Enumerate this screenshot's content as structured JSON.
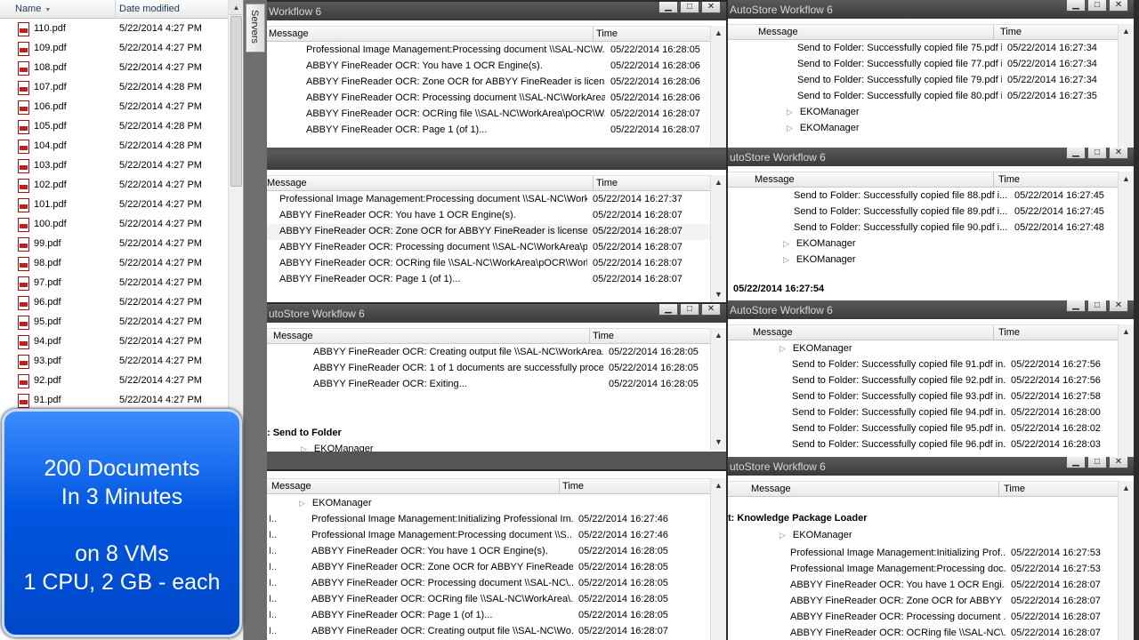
{
  "explorer": {
    "col_name": "Name",
    "col_date": "Date modified",
    "files": [
      {
        "name": "110.pdf",
        "date": "5/22/2014 4:27 PM"
      },
      {
        "name": "109.pdf",
        "date": "5/22/2014 4:27 PM"
      },
      {
        "name": "108.pdf",
        "date": "5/22/2014 4:27 PM"
      },
      {
        "name": "107.pdf",
        "date": "5/22/2014 4:28 PM"
      },
      {
        "name": "106.pdf",
        "date": "5/22/2014 4:27 PM"
      },
      {
        "name": "105.pdf",
        "date": "5/22/2014 4:28 PM"
      },
      {
        "name": "104.pdf",
        "date": "5/22/2014 4:28 PM"
      },
      {
        "name": "103.pdf",
        "date": "5/22/2014 4:27 PM"
      },
      {
        "name": "102.pdf",
        "date": "5/22/2014 4:27 PM"
      },
      {
        "name": "101.pdf",
        "date": "5/22/2014 4:27 PM"
      },
      {
        "name": "100.pdf",
        "date": "5/22/2014 4:27 PM"
      },
      {
        "name": "99.pdf",
        "date": "5/22/2014 4:27 PM"
      },
      {
        "name": "98.pdf",
        "date": "5/22/2014 4:27 PM"
      },
      {
        "name": "97.pdf",
        "date": "5/22/2014 4:27 PM"
      },
      {
        "name": "96.pdf",
        "date": "5/22/2014 4:27 PM"
      },
      {
        "name": "95.pdf",
        "date": "5/22/2014 4:27 PM"
      },
      {
        "name": "94.pdf",
        "date": "5/22/2014 4:27 PM"
      },
      {
        "name": "93.pdf",
        "date": "5/22/2014 4:27 PM"
      },
      {
        "name": "92.pdf",
        "date": "5/22/2014 4:27 PM"
      },
      {
        "name": "91.pdf",
        "date": "5/22/2014 4:27 PM"
      }
    ]
  },
  "servers_tab": "Servers",
  "callout": {
    "line1": "200 Documents",
    "line2": "In 3 Minutes",
    "line3": "on 8 VMs",
    "line4": "1 CPU, 2 GB - each"
  },
  "col_message": "Message",
  "col_time": "Time",
  "win_buttons": {
    "min": "▁",
    "max": "□",
    "close": "✕"
  },
  "windows": {
    "w1": {
      "title": "Workflow 6",
      "rows": [
        {
          "m": "Professional Image Management:Processing document \\\\SAL-NC\\W...",
          "t": "05/22/2014 16:28:05"
        },
        {
          "m": "ABBYY FineReader OCR:  You have 1 OCR Engine(s).",
          "t": "05/22/2014 16:28:06"
        },
        {
          "m": "ABBYY FineReader OCR:  Zone OCR for ABBYY FineReader is licensed.",
          "t": "05/22/2014 16:28:06"
        },
        {
          "m": "ABBYY FineReader OCR:  Processing document \\\\SAL-NC\\WorkArea...",
          "t": "05/22/2014 16:28:06"
        },
        {
          "m": "ABBYY FineReader OCR:  OCRing file \\\\SAL-NC\\WorkArea\\pOCR\\W...",
          "t": "05/22/2014 16:28:07"
        },
        {
          "m": "ABBYY FineReader OCR:  Page 1 (of 1)...",
          "t": "05/22/2014 16:28:07"
        }
      ]
    },
    "w2": {
      "title": "",
      "rows": [
        {
          "m": "Professional Image Management:Processing document \\\\SAL-NC\\Work...",
          "t": "05/22/2014 16:27:37"
        },
        {
          "m": "ABBYY FineReader OCR:  You have 1 OCR Engine(s).",
          "t": "05/22/2014 16:28:07"
        },
        {
          "m": "ABBYY FineReader OCR:  Zone OCR for ABBYY FineReader is licensed.",
          "t": "05/22/2014 16:28:07"
        },
        {
          "m": "ABBYY FineReader OCR:  Processing document \\\\SAL-NC\\WorkArea\\p...",
          "t": "05/22/2014 16:28:07"
        },
        {
          "m": "ABBYY FineReader OCR:  OCRing file \\\\SAL-NC\\WorkArea\\pOCR\\Work...",
          "t": "05/22/2014 16:28:07"
        },
        {
          "m": "ABBYY FineReader OCR:  Page 1 (of 1)...",
          "t": "05/22/2014 16:28:07"
        }
      ]
    },
    "w3": {
      "title": "utoStore Workflow 6",
      "rows": [
        {
          "m": "ABBYY FineReader OCR:  Creating output file \\\\SAL-NC\\WorkArea...",
          "t": "05/22/2014 16:28:05"
        },
        {
          "m": "ABBYY FineReader OCR:  1 of 1 documents are successfully proce...",
          "t": "05/22/2014 16:28:05"
        },
        {
          "m": "ABBYY FineReader OCR:  Exiting...",
          "t": "05/22/2014 16:28:05"
        }
      ],
      "group": ": Send to Folder",
      "node": "EKOManager"
    },
    "w4": {
      "title": "",
      "node": "EKOManager",
      "rows": [
        {
          "s": "I..",
          "m": "Professional Image Management:Initializing Professional Im...",
          "t": "05/22/2014 16:27:46"
        },
        {
          "s": "I..",
          "m": "Professional Image Management:Processing document \\\\S...",
          "t": "05/22/2014 16:27:46"
        },
        {
          "s": "I..",
          "m": "ABBYY FineReader OCR:  You have 1 OCR Engine(s).",
          "t": "05/22/2014 16:28:05"
        },
        {
          "s": "I..",
          "m": "ABBYY FineReader OCR:  Zone OCR for ABBYY FineReader...",
          "t": "05/22/2014 16:28:05"
        },
        {
          "s": "I..",
          "m": "ABBYY FineReader OCR:  Processing document \\\\SAL-NC\\...",
          "t": "05/22/2014 16:28:05"
        },
        {
          "s": "I..",
          "m": "ABBYY FineReader OCR:  OCRing file \\\\SAL-NC\\WorkArea\\...",
          "t": "05/22/2014 16:28:05"
        },
        {
          "s": "I..",
          "m": "ABBYY FineReader OCR:  Page 1 (of 1)...",
          "t": "05/22/2014 16:28:05"
        },
        {
          "s": "I..",
          "m": "ABBYY FineReader OCR:  Creating output file \\\\SAL-NC\\Wo...",
          "t": "05/22/2014 16:28:07"
        }
      ]
    },
    "w5": {
      "title": "AutoStore Workflow 6",
      "rows": [
        {
          "m": "Send to Folder:  Successfully copied file 75.pdf i...",
          "t": "05/22/2014 16:27:34"
        },
        {
          "m": "Send to Folder:  Successfully copied file 77.pdf i...",
          "t": "05/22/2014 16:27:34"
        },
        {
          "m": "Send to Folder:  Successfully copied file 79.pdf i...",
          "t": "05/22/2014 16:27:34"
        },
        {
          "m": "Send to Folder:  Successfully copied file 80.pdf i...",
          "t": "05/22/2014 16:27:35"
        }
      ],
      "nodes": [
        "EKOManager",
        "EKOManager"
      ]
    },
    "w6": {
      "title": "utoStore Workflow 6",
      "rows": [
        {
          "m": "Send to Folder:  Successfully copied file 88.pdf i...",
          "t": "05/22/2014 16:27:45"
        },
        {
          "m": "Send to Folder:  Successfully copied file 89.pdf i...",
          "t": "05/22/2014 16:27:45"
        },
        {
          "m": "Send to Folder:  Successfully copied file 90.pdf i...",
          "t": "05/22/2014 16:27:48"
        }
      ],
      "nodes": [
        "EKOManager",
        "EKOManager"
      ],
      "timestamp": "05/22/2014 16:27:54"
    },
    "w7": {
      "title": "AutoStore Workflow 6",
      "node": "EKOManager",
      "rows": [
        {
          "m": "Send to Folder:  Successfully copied file 91.pdf in...",
          "t": "05/22/2014 16:27:56"
        },
        {
          "m": "Send to Folder:  Successfully copied file 92.pdf in...",
          "t": "05/22/2014 16:27:56"
        },
        {
          "m": "Send to Folder:  Successfully copied file 93.pdf in...",
          "t": "05/22/2014 16:27:58"
        },
        {
          "m": "Send to Folder:  Successfully copied file 94.pdf in...",
          "t": "05/22/2014 16:28:00"
        },
        {
          "m": "Send to Folder:  Successfully copied file 95.pdf in...",
          "t": "05/22/2014 16:28:02"
        },
        {
          "m": "Send to Folder:  Successfully copied file 96.pdf in...",
          "t": "05/22/2014 16:28:03"
        }
      ]
    },
    "w8": {
      "title": "utoStore Workflow 6",
      "group": "t: Knowledge Package Loader",
      "node": "EKOManager",
      "rows": [
        {
          "m": "Professional Image Management:Initializing Prof...",
          "t": "05/22/2014 16:27:53"
        },
        {
          "m": "Professional Image Management:Processing doc...",
          "t": "05/22/2014 16:27:53"
        },
        {
          "m": "ABBYY FineReader OCR:  You have 1 OCR Engi...",
          "t": "05/22/2014 16:28:07"
        },
        {
          "m": "ABBYY FineReader OCR:  Zone OCR for ABBYY ...",
          "t": "05/22/2014 16:28:07"
        },
        {
          "m": "ABBYY FineReader OCR:  Processing document ...",
          "t": "05/22/2014 16:28:07"
        },
        {
          "m": "ABBYY FineReader OCR:  OCRing file \\\\SAL-NC\\...",
          "t": "05/22/2014 16:28:07"
        }
      ]
    }
  }
}
